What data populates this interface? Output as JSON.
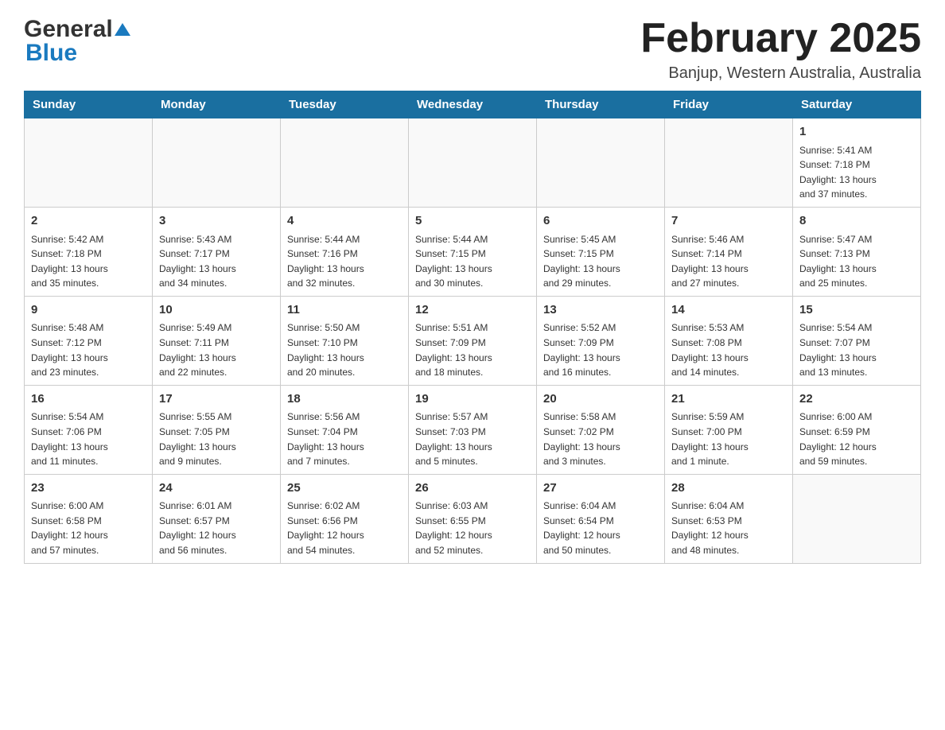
{
  "header": {
    "logo_general": "General",
    "logo_blue": "Blue",
    "month_title": "February 2025",
    "subtitle": "Banjup, Western Australia, Australia"
  },
  "days_of_week": [
    "Sunday",
    "Monday",
    "Tuesday",
    "Wednesday",
    "Thursday",
    "Friday",
    "Saturday"
  ],
  "weeks": [
    [
      {
        "day": "",
        "info": ""
      },
      {
        "day": "",
        "info": ""
      },
      {
        "day": "",
        "info": ""
      },
      {
        "day": "",
        "info": ""
      },
      {
        "day": "",
        "info": ""
      },
      {
        "day": "",
        "info": ""
      },
      {
        "day": "1",
        "info": "Sunrise: 5:41 AM\nSunset: 7:18 PM\nDaylight: 13 hours\nand 37 minutes."
      }
    ],
    [
      {
        "day": "2",
        "info": "Sunrise: 5:42 AM\nSunset: 7:18 PM\nDaylight: 13 hours\nand 35 minutes."
      },
      {
        "day": "3",
        "info": "Sunrise: 5:43 AM\nSunset: 7:17 PM\nDaylight: 13 hours\nand 34 minutes."
      },
      {
        "day": "4",
        "info": "Sunrise: 5:44 AM\nSunset: 7:16 PM\nDaylight: 13 hours\nand 32 minutes."
      },
      {
        "day": "5",
        "info": "Sunrise: 5:44 AM\nSunset: 7:15 PM\nDaylight: 13 hours\nand 30 minutes."
      },
      {
        "day": "6",
        "info": "Sunrise: 5:45 AM\nSunset: 7:15 PM\nDaylight: 13 hours\nand 29 minutes."
      },
      {
        "day": "7",
        "info": "Sunrise: 5:46 AM\nSunset: 7:14 PM\nDaylight: 13 hours\nand 27 minutes."
      },
      {
        "day": "8",
        "info": "Sunrise: 5:47 AM\nSunset: 7:13 PM\nDaylight: 13 hours\nand 25 minutes."
      }
    ],
    [
      {
        "day": "9",
        "info": "Sunrise: 5:48 AM\nSunset: 7:12 PM\nDaylight: 13 hours\nand 23 minutes."
      },
      {
        "day": "10",
        "info": "Sunrise: 5:49 AM\nSunset: 7:11 PM\nDaylight: 13 hours\nand 22 minutes."
      },
      {
        "day": "11",
        "info": "Sunrise: 5:50 AM\nSunset: 7:10 PM\nDaylight: 13 hours\nand 20 minutes."
      },
      {
        "day": "12",
        "info": "Sunrise: 5:51 AM\nSunset: 7:09 PM\nDaylight: 13 hours\nand 18 minutes."
      },
      {
        "day": "13",
        "info": "Sunrise: 5:52 AM\nSunset: 7:09 PM\nDaylight: 13 hours\nand 16 minutes."
      },
      {
        "day": "14",
        "info": "Sunrise: 5:53 AM\nSunset: 7:08 PM\nDaylight: 13 hours\nand 14 minutes."
      },
      {
        "day": "15",
        "info": "Sunrise: 5:54 AM\nSunset: 7:07 PM\nDaylight: 13 hours\nand 13 minutes."
      }
    ],
    [
      {
        "day": "16",
        "info": "Sunrise: 5:54 AM\nSunset: 7:06 PM\nDaylight: 13 hours\nand 11 minutes."
      },
      {
        "day": "17",
        "info": "Sunrise: 5:55 AM\nSunset: 7:05 PM\nDaylight: 13 hours\nand 9 minutes."
      },
      {
        "day": "18",
        "info": "Sunrise: 5:56 AM\nSunset: 7:04 PM\nDaylight: 13 hours\nand 7 minutes."
      },
      {
        "day": "19",
        "info": "Sunrise: 5:57 AM\nSunset: 7:03 PM\nDaylight: 13 hours\nand 5 minutes."
      },
      {
        "day": "20",
        "info": "Sunrise: 5:58 AM\nSunset: 7:02 PM\nDaylight: 13 hours\nand 3 minutes."
      },
      {
        "day": "21",
        "info": "Sunrise: 5:59 AM\nSunset: 7:00 PM\nDaylight: 13 hours\nand 1 minute."
      },
      {
        "day": "22",
        "info": "Sunrise: 6:00 AM\nSunset: 6:59 PM\nDaylight: 12 hours\nand 59 minutes."
      }
    ],
    [
      {
        "day": "23",
        "info": "Sunrise: 6:00 AM\nSunset: 6:58 PM\nDaylight: 12 hours\nand 57 minutes."
      },
      {
        "day": "24",
        "info": "Sunrise: 6:01 AM\nSunset: 6:57 PM\nDaylight: 12 hours\nand 56 minutes."
      },
      {
        "day": "25",
        "info": "Sunrise: 6:02 AM\nSunset: 6:56 PM\nDaylight: 12 hours\nand 54 minutes."
      },
      {
        "day": "26",
        "info": "Sunrise: 6:03 AM\nSunset: 6:55 PM\nDaylight: 12 hours\nand 52 minutes."
      },
      {
        "day": "27",
        "info": "Sunrise: 6:04 AM\nSunset: 6:54 PM\nDaylight: 12 hours\nand 50 minutes."
      },
      {
        "day": "28",
        "info": "Sunrise: 6:04 AM\nSunset: 6:53 PM\nDaylight: 12 hours\nand 48 minutes."
      },
      {
        "day": "",
        "info": ""
      }
    ]
  ]
}
